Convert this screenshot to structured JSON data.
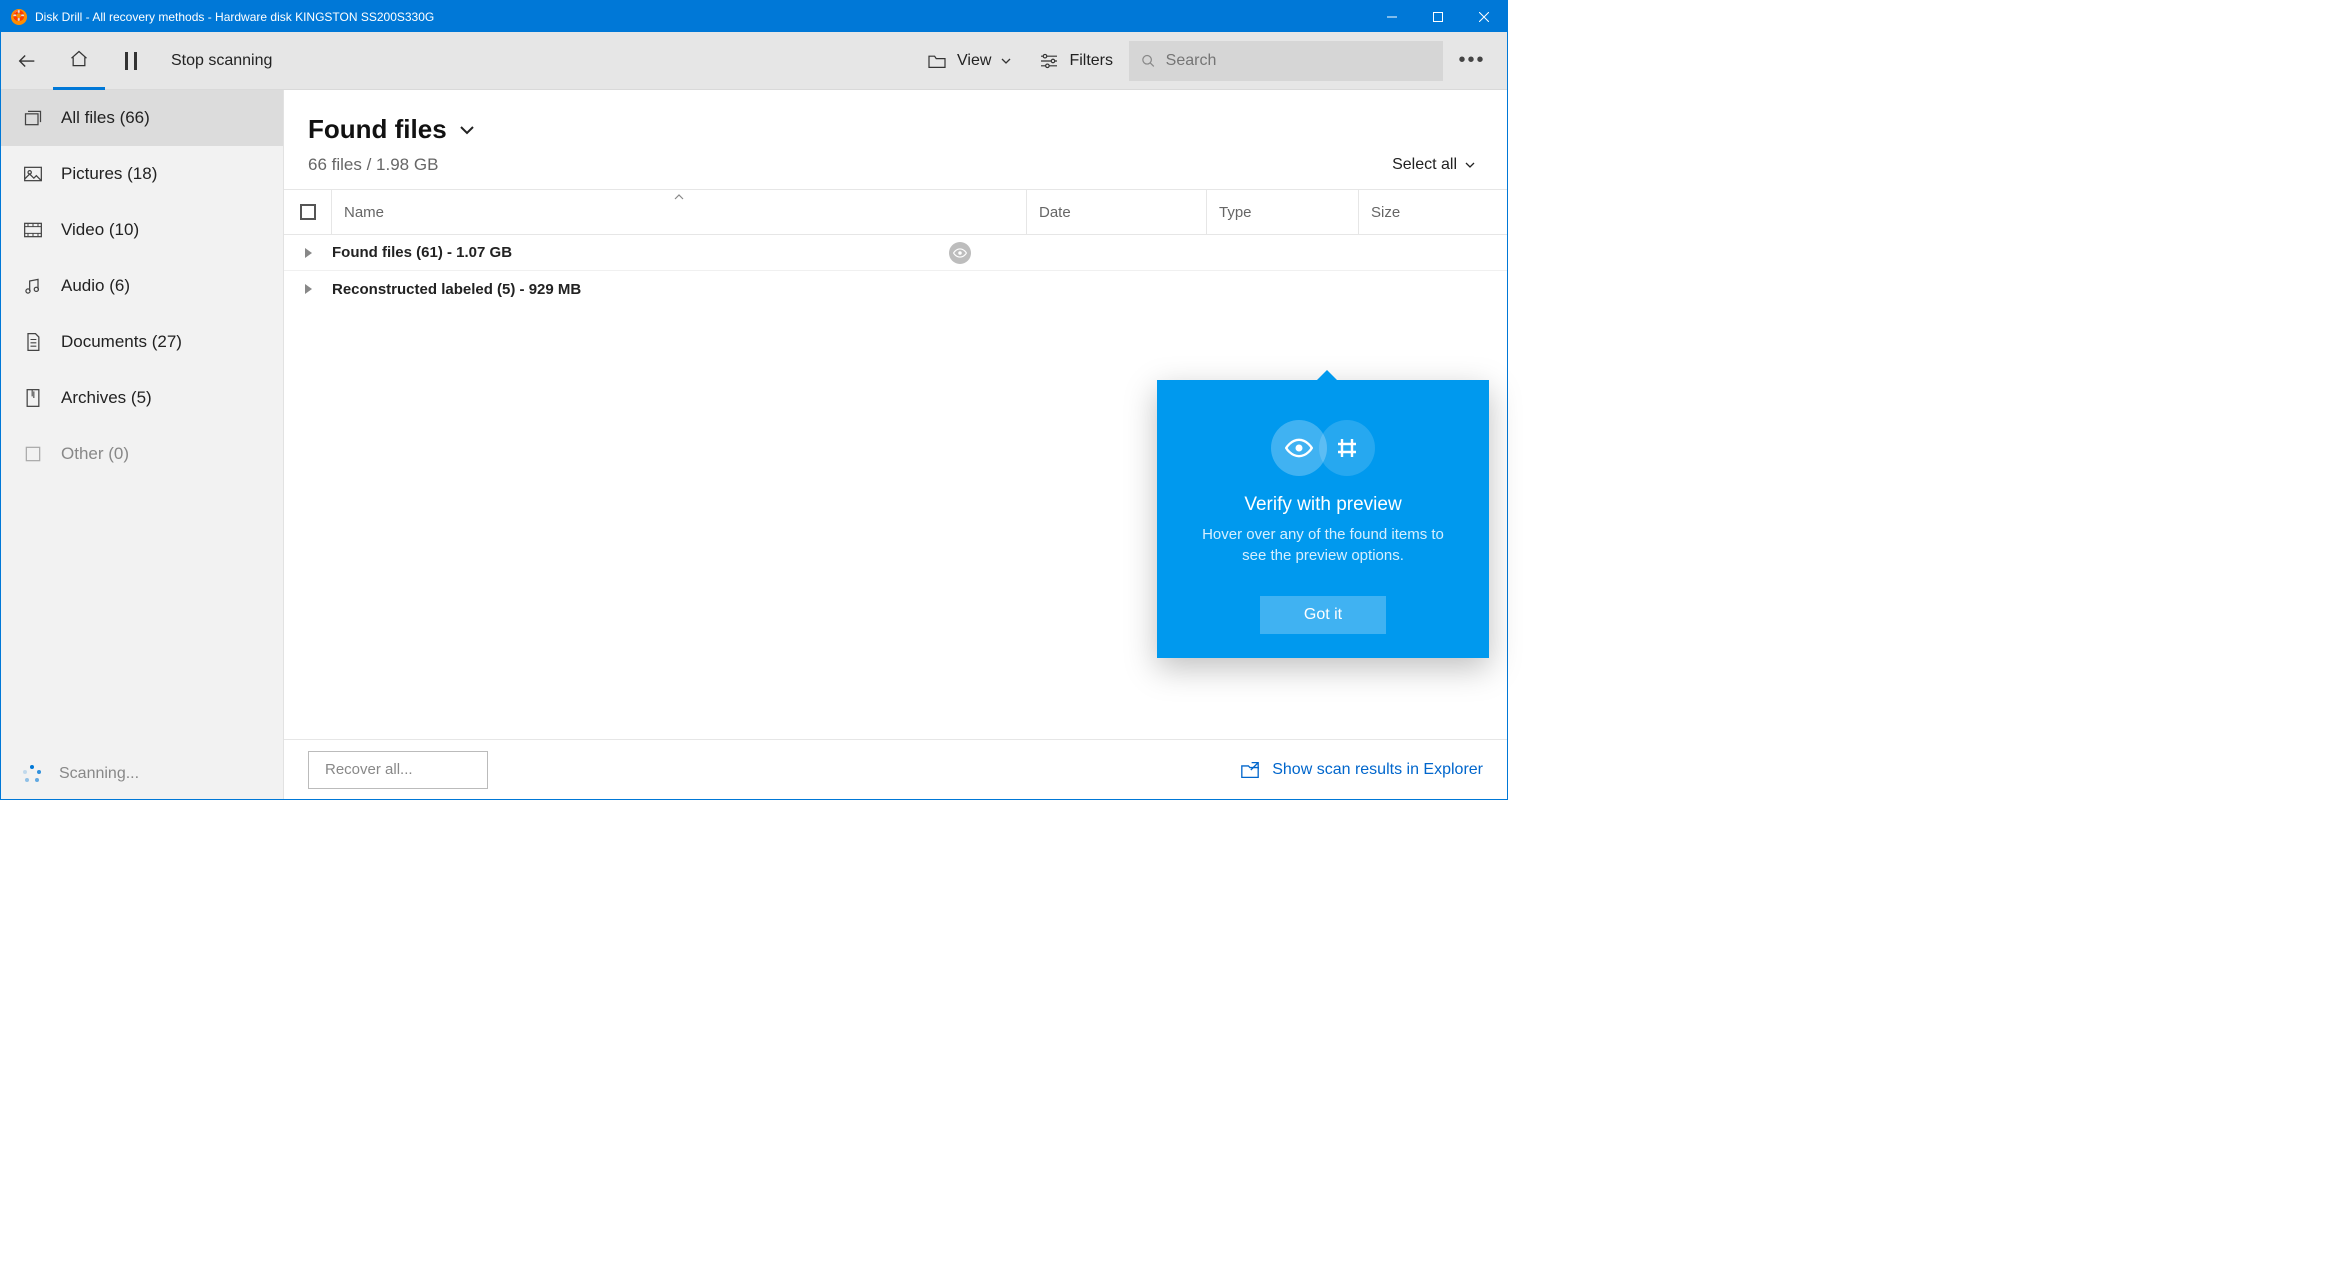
{
  "titlebar": {
    "title": "Disk Drill - All recovery methods - Hardware disk KINGSTON SS200S330G"
  },
  "toolbar": {
    "stop_label": "Stop scanning",
    "view_label": "View",
    "filters_label": "Filters",
    "search_placeholder": "Search"
  },
  "sidebar": {
    "items": [
      {
        "label": "All files (66)"
      },
      {
        "label": "Pictures (18)"
      },
      {
        "label": "Video (10)"
      },
      {
        "label": "Audio (6)"
      },
      {
        "label": "Documents (27)"
      },
      {
        "label": "Archives (5)"
      },
      {
        "label": "Other (0)"
      }
    ],
    "status": "Scanning..."
  },
  "main": {
    "title": "Found files",
    "subtitle": "66 files / 1.98 GB",
    "select_all": "Select all",
    "columns": {
      "name": "Name",
      "date": "Date",
      "type": "Type",
      "size": "Size"
    },
    "rows": [
      {
        "label": "Found files (61) - 1.07 GB"
      },
      {
        "label": "Reconstructed labeled (5) - 929 MB"
      }
    ]
  },
  "footer": {
    "recover": "Recover all...",
    "explorer": "Show scan results in Explorer"
  },
  "popover": {
    "title": "Verify with preview",
    "text": "Hover over any of the found items to see the preview options.",
    "button": "Got it"
  }
}
